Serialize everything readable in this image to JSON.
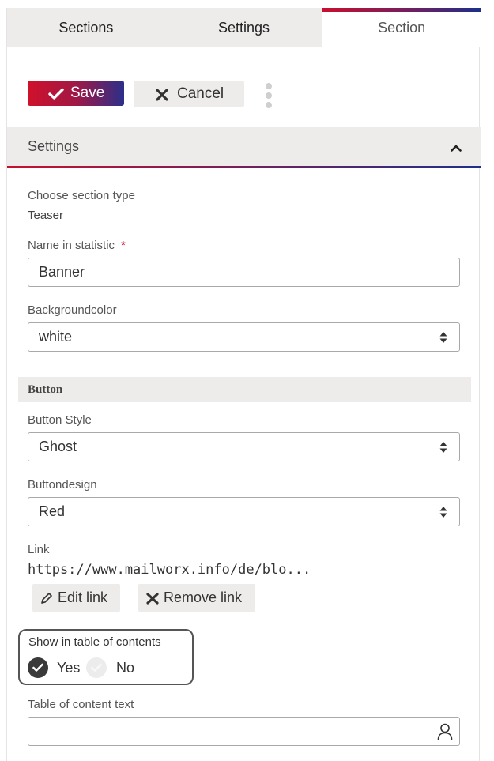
{
  "tabs": [
    {
      "label": "Sections"
    },
    {
      "label": "Settings"
    },
    {
      "label": "Section",
      "active": true
    }
  ],
  "toolbar": {
    "save_label": "Save",
    "cancel_label": "Cancel",
    "more_icon": "vertical-ellipsis-icon"
  },
  "settings": {
    "header": "Settings",
    "toggle_icon": "chevron-up-icon",
    "section_type_label": "Choose section type",
    "section_type_value": "Teaser",
    "name_label": "Name in statistic",
    "name_required_mark": "*",
    "name_value": "Banner",
    "bgcolor_label": "Backgroundcolor",
    "bgcolor_value": "white"
  },
  "button_group": {
    "header": "Button",
    "style_label": "Button Style",
    "style_value": "Ghost",
    "design_label": "Buttondesign",
    "design_value": "Red",
    "link_label": "Link",
    "link_value": "https://www.mailworx.info/de/blo...",
    "edit_link_label": "Edit link",
    "remove_link_label": "Remove link"
  },
  "toc": {
    "label": "Show in table of contents",
    "yes_label": "Yes",
    "no_label": "No",
    "selected": "Yes",
    "text_label": "Table of content text",
    "text_value": "",
    "text_icon": "person-icon"
  },
  "colors": {
    "accent_red": "#c8102e",
    "accent_blue": "#1e2f8a",
    "panel_gray": "#eeeceb"
  }
}
